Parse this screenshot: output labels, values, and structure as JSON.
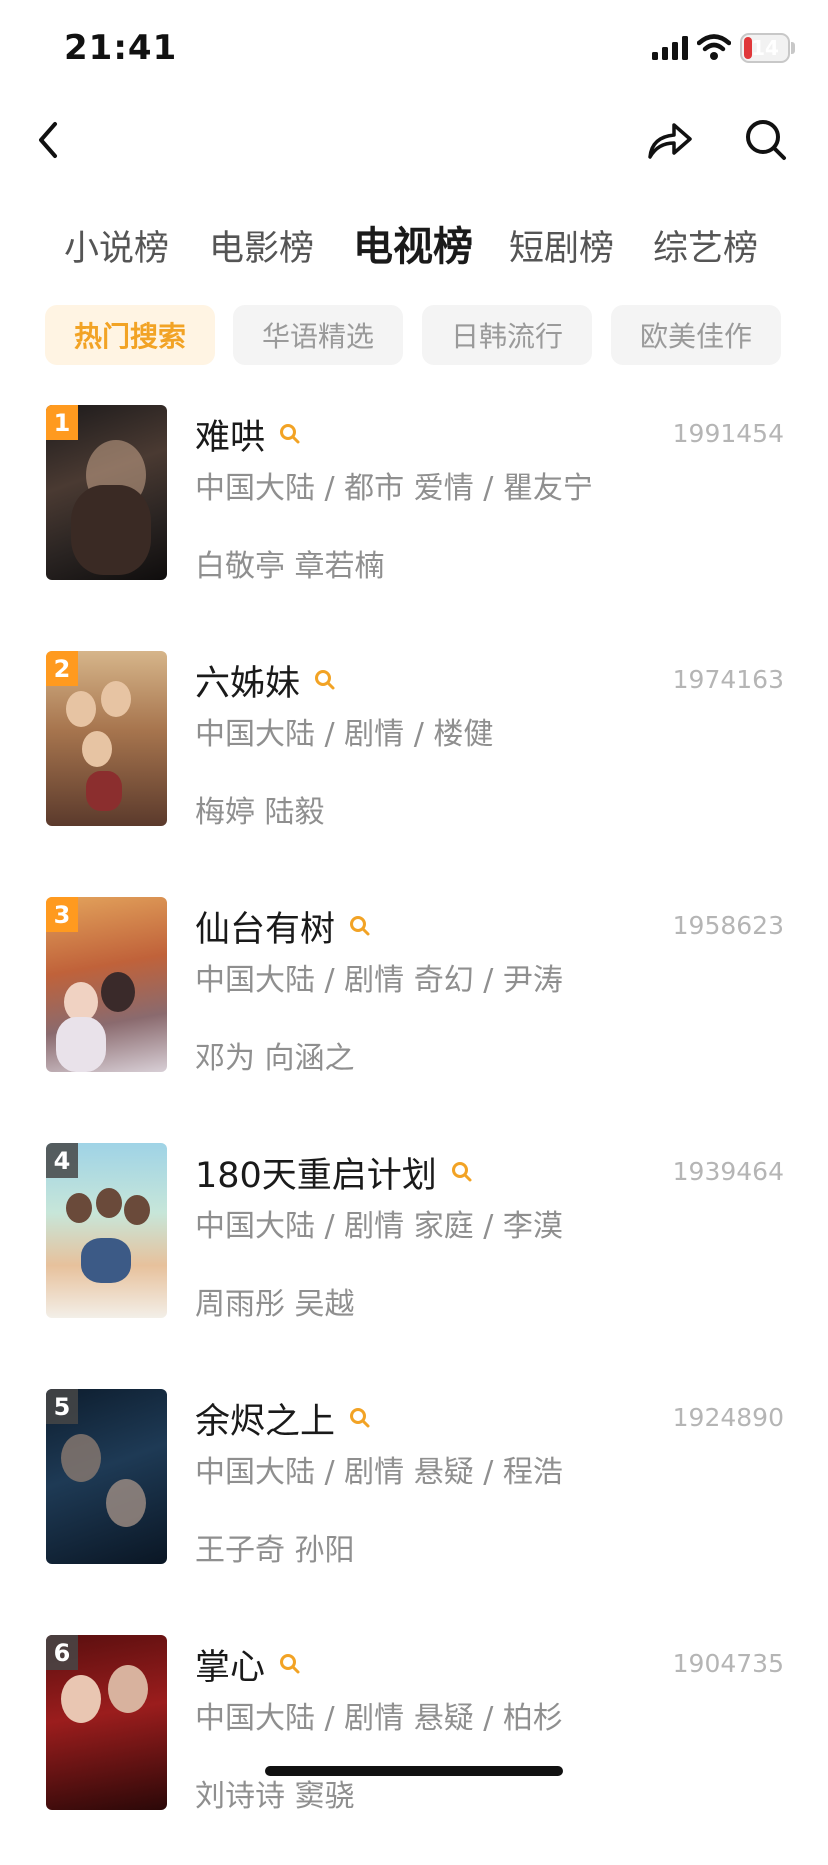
{
  "status": {
    "time": "21:41",
    "battery": "14"
  },
  "nav": {
    "back_icon": "chevron-left-icon",
    "share_icon": "share-icon",
    "search_icon": "search-icon"
  },
  "tabs": [
    {
      "label": "小说榜",
      "active": false
    },
    {
      "label": "电影榜",
      "active": false
    },
    {
      "label": "电视榜",
      "active": true
    },
    {
      "label": "短剧榜",
      "active": false
    },
    {
      "label": "综艺榜",
      "active": false
    }
  ],
  "chips": [
    {
      "label": "热门搜索",
      "active": true
    },
    {
      "label": "华语精选",
      "active": false
    },
    {
      "label": "日韩流行",
      "active": false
    },
    {
      "label": "欧美佳作",
      "active": false
    }
  ],
  "items": [
    {
      "rank": "1",
      "title": "难哄",
      "count": "1991454",
      "meta": "中国大陆 / 都市 爱情 / 瞿友宁",
      "cast": "白敬亭 章若楠"
    },
    {
      "rank": "2",
      "title": "六姊妹",
      "count": "1974163",
      "meta": "中国大陆 / 剧情 / 楼健",
      "cast": "梅婷 陆毅"
    },
    {
      "rank": "3",
      "title": "仙台有树",
      "count": "1958623",
      "meta": "中国大陆 / 剧情 奇幻 / 尹涛",
      "cast": "邓为 向涵之"
    },
    {
      "rank": "4",
      "title": "180天重启计划",
      "count": "1939464",
      "meta": "中国大陆 / 剧情 家庭 / 李漠",
      "cast": "周雨彤 吴越"
    },
    {
      "rank": "5",
      "title": "余烬之上",
      "count": "1924890",
      "meta": "中国大陆 / 剧情 悬疑 / 程浩",
      "cast": "王子奇 孙阳"
    },
    {
      "rank": "6",
      "title": "掌心",
      "count": "1904735",
      "meta": "中国大陆 / 剧情 悬疑 / 柏杉",
      "cast": "刘诗诗 窦骁"
    }
  ],
  "colors": {
    "accent": "#f2a325",
    "rank_top": "#ff9a1f",
    "chip_active_bg": "#fff4e3"
  }
}
